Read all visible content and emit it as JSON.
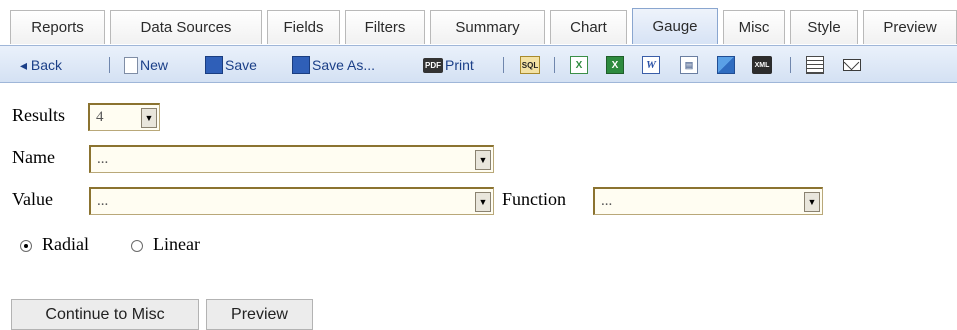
{
  "tabs": [
    "Reports",
    "Data Sources",
    "Fields",
    "Filters",
    "Summary",
    "Chart",
    "Gauge",
    "Misc",
    "Style",
    "Preview"
  ],
  "active_tab": "Gauge",
  "toolbar": {
    "back": "◂ Back",
    "new": "New",
    "save": "Save",
    "save_as": "Save As...",
    "print": "Print",
    "print_icon": "PDF",
    "sql_icon": "SQL",
    "xls_icon": "X",
    "word_icon": "W",
    "doc_icon": "▤",
    "disk_icon": "XML"
  },
  "form": {
    "results_label": "Results",
    "results_value": "4",
    "name_label": "Name",
    "name_value": "...",
    "value_label": "Value",
    "value_value": "...",
    "function_label": "Function",
    "function_value": "...",
    "radial_label": "Radial",
    "linear_label": "Linear",
    "gauge_type": "Radial"
  },
  "buttons": {
    "continue": "Continue to Misc",
    "preview": "Preview"
  },
  "colors": {
    "toolbar_text": "#1b3f88",
    "field_border": "#8b7330",
    "active_tab": "#d7e3f5"
  }
}
